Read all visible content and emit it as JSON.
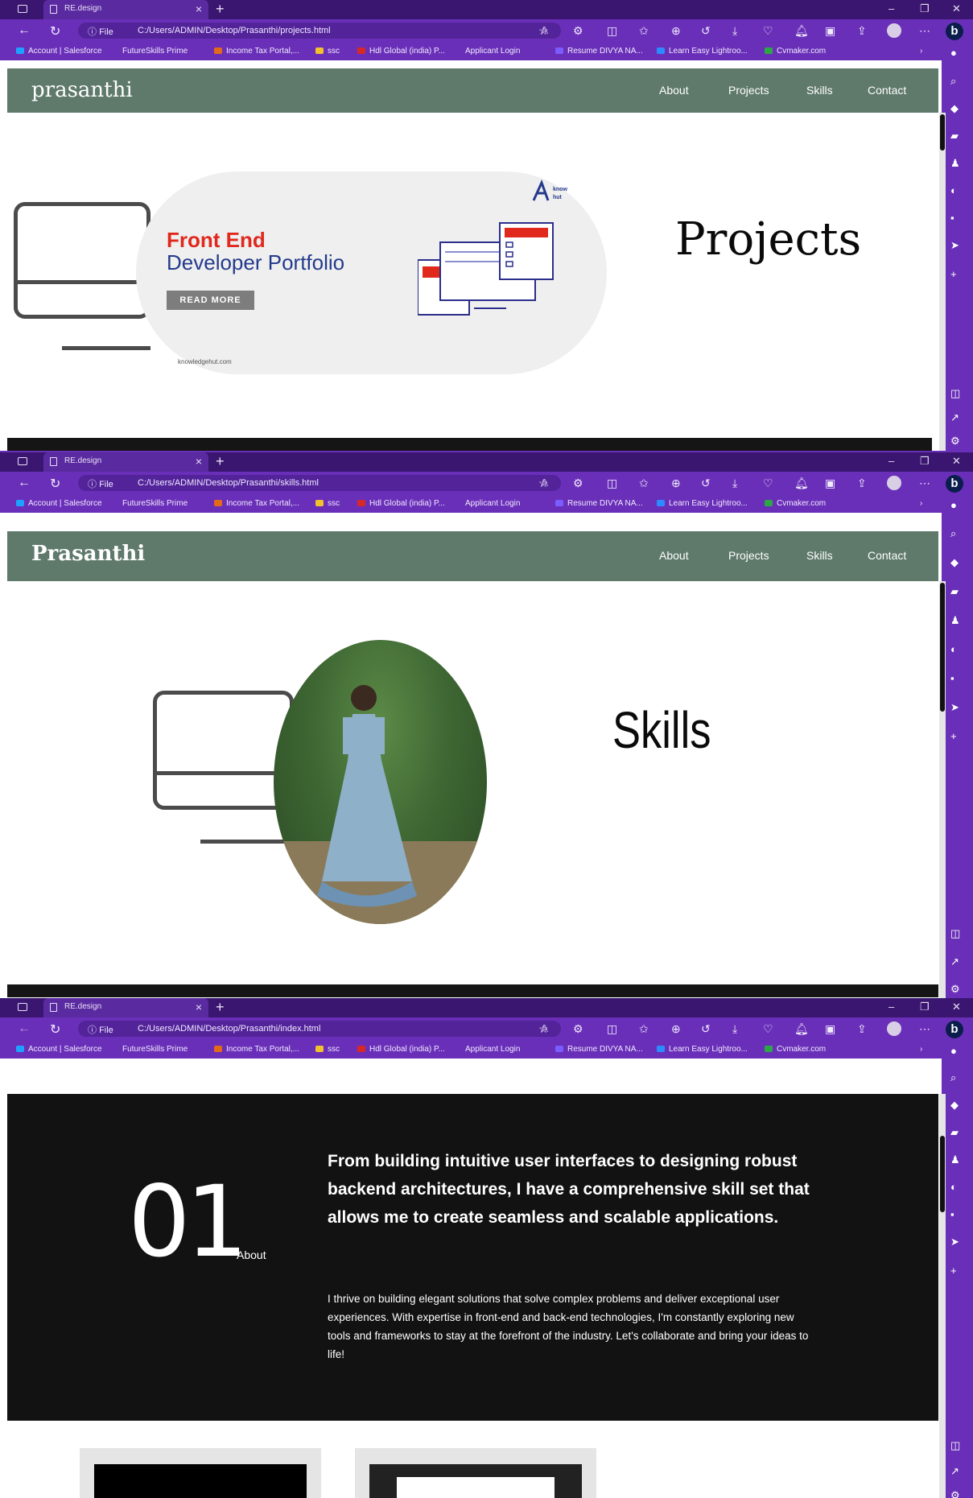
{
  "browser": {
    "tab_title": "RE.design",
    "urls": [
      "C:/Users/ADMIN/Desktop/Prasanthi/projects.html",
      "C:/Users/ADMIN/Desktop/Prasanthi/skills.html",
      "C:/Users/ADMIN/Desktop/Prasanthi/index.html"
    ],
    "file_label": "File",
    "bookmarks": [
      "Account | Salesforce",
      "FutureSkills Prime",
      "Income Tax Portal,...",
      "ssc",
      "Hdl Global (india) P...",
      "Applicant Login",
      "Resume DIVYA NA...",
      "Learn Easy Lightroo...",
      "Cvmaker.com"
    ]
  },
  "nav": {
    "brand_1": "prasanthi",
    "brand_2": "Prasanthi",
    "items": [
      "About",
      "Projects",
      "Skills",
      "Contact"
    ]
  },
  "projects": {
    "title": "Projects",
    "banner": {
      "line1": "Front End",
      "line2": "Developer Portfolio",
      "button": "READ MORE",
      "site": "knowledgehut.com"
    }
  },
  "skills": {
    "title": "Skills"
  },
  "about": {
    "number": "01",
    "label": "About",
    "heading": "From building intuitive user interfaces to designing robust backend architectures, I have a comprehensive skill set that allows me to create seamless and scalable applications.",
    "body": "I thrive on building elegant solutions that solve complex problems and deliver exceptional user experiences. With expertise in front-end and back-end technologies, I'm constantly exploring new tools and frameworks to stay at the forefront of the industry. Let's collaborate and bring your ideas to life!"
  }
}
